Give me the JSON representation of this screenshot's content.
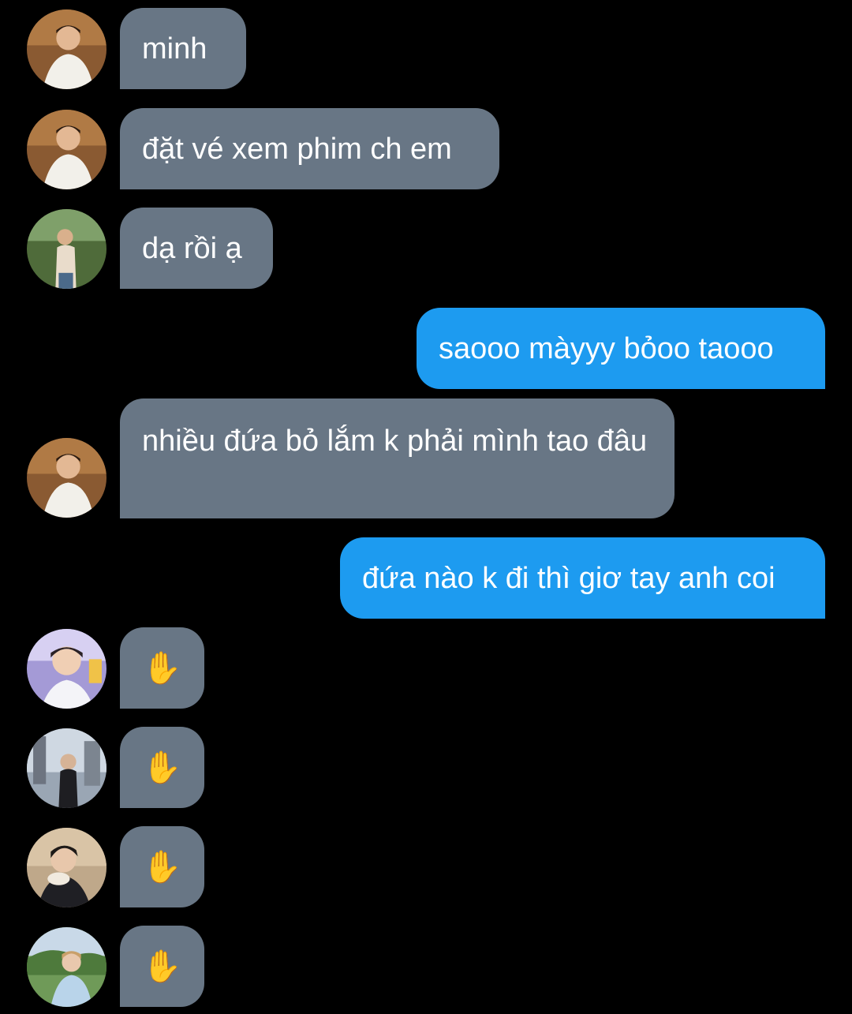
{
  "messages": [
    {
      "id": "m1",
      "direction": "incoming",
      "sender_avatar": "avatar-user-a",
      "text": "minh"
    },
    {
      "id": "m2",
      "direction": "incoming",
      "sender_avatar": "avatar-user-a",
      "text": "đặt vé xem phim ch em"
    },
    {
      "id": "m3",
      "direction": "incoming",
      "sender_avatar": "avatar-user-b",
      "text": "dạ rồi ạ"
    },
    {
      "id": "m4",
      "direction": "outgoing",
      "text": "saooo màyyy bỏoo taooo"
    },
    {
      "id": "m5",
      "direction": "incoming",
      "sender_avatar": "avatar-user-a",
      "text": "nhiều đứa bỏ lắm k phải mình tao đâu"
    },
    {
      "id": "m6",
      "direction": "outgoing",
      "text": "đứa nào k đi thì giơ tay anh coi"
    },
    {
      "id": "m7",
      "direction": "incoming",
      "sender_avatar": "avatar-user-c",
      "text": "✋"
    },
    {
      "id": "m8",
      "direction": "incoming",
      "sender_avatar": "avatar-user-d",
      "text": "✋"
    },
    {
      "id": "m9",
      "direction": "incoming",
      "sender_avatar": "avatar-user-e",
      "text": "✋"
    },
    {
      "id": "m10",
      "direction": "incoming",
      "sender_avatar": "avatar-user-f",
      "text": "✋"
    }
  ],
  "colors": {
    "background": "#000000",
    "incoming_bubble": "#687685",
    "outgoing_bubble": "#1d9bf0",
    "text": "#ffffff"
  }
}
